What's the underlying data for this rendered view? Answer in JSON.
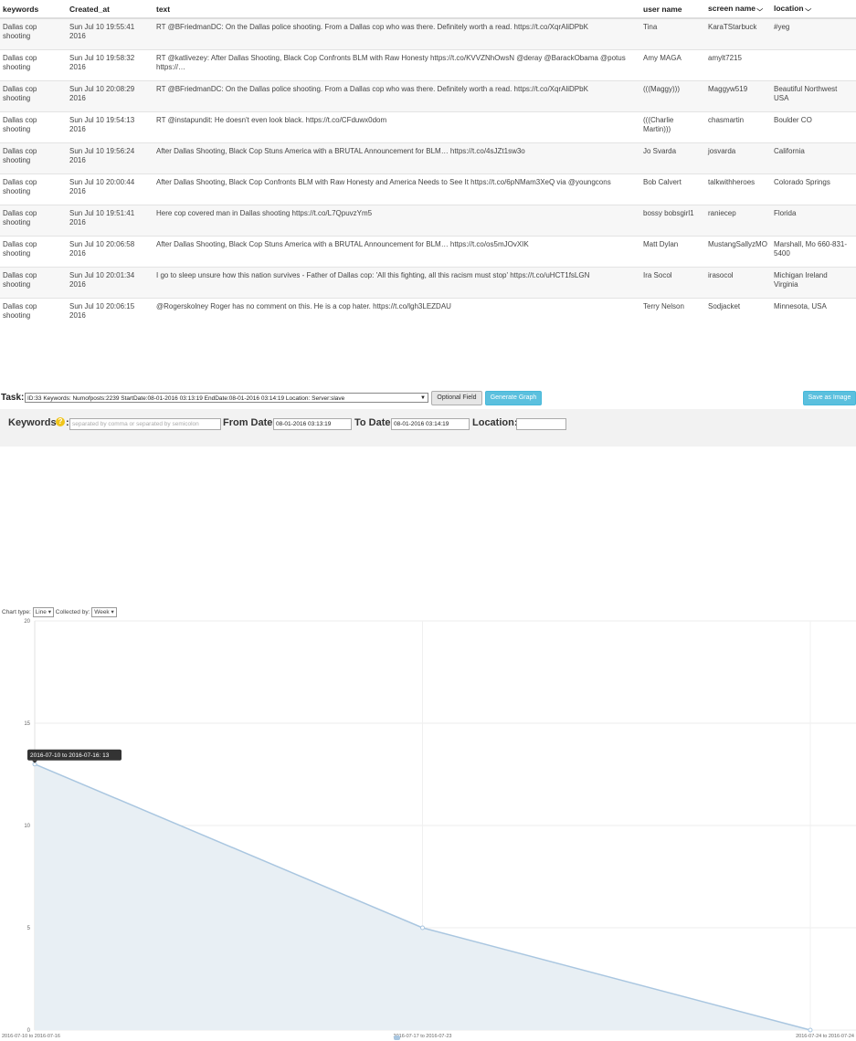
{
  "table": {
    "headers": {
      "keywords": "keywords",
      "created_at": "Created_at",
      "text": "text",
      "user_name": "user name",
      "screen_name": "screen name",
      "location": "location"
    },
    "rows": [
      {
        "keywords": "Dallas cop shooting",
        "created_at": "Sun Jul 10 19:55:41 2016",
        "text": "RT @BFriedmanDC: On the Dallas police shooting. From a Dallas cop who was there. Definitely worth a read. https://t.co/XqrAliDPbK",
        "user_name": "Tina",
        "screen_name": "KaraTStarbuck",
        "location": "#yeg"
      },
      {
        "keywords": "Dallas cop shooting",
        "created_at": "Sun Jul 10 19:58:32 2016",
        "text": "RT @katlivezey: After Dallas Shooting, Black Cop Confronts BLM with Raw Honesty https://t.co/KVVZNhOwsN @deray @BarackObama @potus https://…",
        "user_name": "Amy MAGA",
        "screen_name": "amylt7215",
        "location": ""
      },
      {
        "keywords": "Dallas cop shooting",
        "created_at": "Sun Jul 10 20:08:29 2016",
        "text": "RT @BFriedmanDC: On the Dallas police shooting. From a Dallas cop who was there. Definitely worth a read. https://t.co/XqrAliDPbK",
        "user_name": "(((Maggy)))",
        "screen_name": "Maggyw519",
        "location": "Beautiful Northwest USA"
      },
      {
        "keywords": "Dallas cop shooting",
        "created_at": "Sun Jul 10 19:54:13 2016",
        "text": "RT @instapundit: He doesn't even look black. https://t.co/CFduwx0dom",
        "user_name": "(((Charlie Martin)))",
        "screen_name": "chasmartin",
        "location": "Boulder CO"
      },
      {
        "keywords": "Dallas cop shooting",
        "created_at": "Sun Jul 10 19:56:24 2016",
        "text": "After Dallas Shooting, Black Cop Stuns America with a BRUTAL Announcement for BLM… https://t.co/4sJZt1sw3o",
        "user_name": "Jo Svarda",
        "screen_name": "josvarda",
        "location": "California"
      },
      {
        "keywords": "Dallas cop shooting",
        "created_at": "Sun Jul 10 20:00:44 2016",
        "text": "After Dallas Shooting, Black Cop Confronts BLM with Raw Honesty and America Needs to See It https://t.co/6pNMam3XeQ via @youngcons",
        "user_name": "Bob Calvert",
        "screen_name": "talkwithheroes",
        "location": "Colorado Springs"
      },
      {
        "keywords": "Dallas cop shooting",
        "created_at": "Sun Jul 10 19:51:41 2016",
        "text": "Here cop covered man in Dallas shooting https://t.co/L7QpuvzYm5",
        "user_name": "bossy bobsgirl1",
        "screen_name": "raniecep",
        "location": "Florida"
      },
      {
        "keywords": "Dallas cop shooting",
        "created_at": "Sun Jul 10 20:06:58 2016",
        "text": "After Dallas Shooting, Black Cop Stuns America with a BRUTAL Announcement for BLM… https://t.co/os5mJOvXIK",
        "user_name": "Matt Dylan",
        "screen_name": "MustangSallyzMO",
        "location": "Marshall, Mo 660-831-5400"
      },
      {
        "keywords": "Dallas cop shooting",
        "created_at": "Sun Jul 10 20:01:34 2016",
        "text": "I go to sleep unsure how this nation survives - Father of Dallas cop: 'All this fighting, all this racism must stop' https://t.co/uHCT1fsLGN",
        "user_name": "Ira Socol",
        "screen_name": "irasocol",
        "location": "Michigan Ireland Virginia"
      },
      {
        "keywords": "Dallas cop shooting",
        "created_at": "Sun Jul 10 20:06:15 2016",
        "text": "@Rogerskolney Roger has no comment on this. He is a cop hater. https://t.co/lgh3LEZDAU",
        "user_name": "Terry Nelson",
        "screen_name": "Sodjacket",
        "location": "Minnesota, USA"
      }
    ]
  },
  "task": {
    "label": "Task:",
    "selected": "ID:33 Keywords: Numofposts:2239 StartDate:08-01-2016 03:13:19 EndDate:08-01-2016 03:14:19 Location: Server:slave",
    "optional_field": "Optional Field",
    "generate_graph": "Generate Graph",
    "save_as_image": "Save as Image"
  },
  "filters": {
    "keywords_label": "Keywords",
    "keywords_colon": ":",
    "keywords_placeholder": "separated by comma or separated by semicolon",
    "from_label": "From Date:",
    "from_value": "08-01-2016 03:13:19",
    "to_label": "To Date:",
    "to_value": "08-01-2016 03:14:19",
    "location_label": "Location:",
    "location_value": ""
  },
  "chart_controls": {
    "chart_type_label": "Chart type:",
    "chart_type_value": "Line",
    "collected_by_label": "Collected by:",
    "collected_by_value": "Week"
  },
  "chart_data": {
    "type": "area",
    "categories": [
      "2016-07-10 to 2016-07-16",
      "2016-07-17 to 2016-07-23",
      "2016-07-24 to 2016-07-24"
    ],
    "values": [
      13,
      5,
      0
    ],
    "ylim": [
      0,
      20
    ],
    "yticks": [
      0,
      5,
      10,
      15,
      20
    ],
    "tooltip": "2016-07-10 to 2016-07-16: 13",
    "line_color": "#a9c6e0",
    "fill_color": "#e8eff4",
    "grid": true
  },
  "colors": {
    "info_button": "#5bc0de",
    "help_icon": "#f0c419"
  }
}
